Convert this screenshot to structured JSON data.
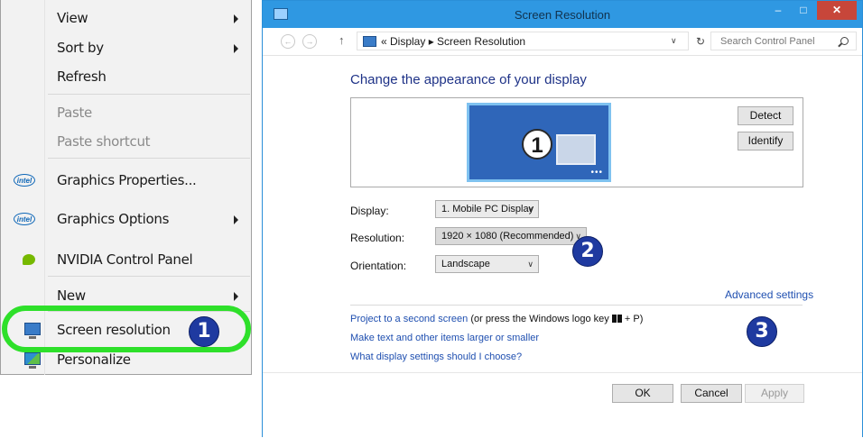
{
  "context_menu": {
    "items": [
      {
        "label": "View",
        "has_submenu": true,
        "disabled": false
      },
      {
        "label": "Sort by",
        "has_submenu": true,
        "disabled": false
      },
      {
        "label": "Refresh",
        "has_submenu": false,
        "disabled": false
      },
      {
        "label": "Paste",
        "has_submenu": false,
        "disabled": true
      },
      {
        "label": "Paste shortcut",
        "has_submenu": false,
        "disabled": true
      },
      {
        "label": "Graphics Properties...",
        "icon": "intel-icon",
        "has_submenu": false,
        "disabled": false
      },
      {
        "label": "Graphics Options",
        "icon": "intel-icon",
        "has_submenu": true,
        "disabled": false
      },
      {
        "label": "NVIDIA Control Panel",
        "icon": "nvidia-icon",
        "has_submenu": false,
        "disabled": false
      },
      {
        "label": "New",
        "has_submenu": true,
        "disabled": false
      },
      {
        "label": "Screen resolution",
        "icon": "monitor-icon",
        "has_submenu": false,
        "disabled": false
      },
      {
        "label": "Personalize",
        "icon": "personalize-icon",
        "has_submenu": false,
        "disabled": false
      }
    ],
    "intel_icon_text": "intel",
    "highlight_color": "#2ee02a"
  },
  "badges": {
    "one": "1",
    "two": "2",
    "three": "3",
    "color": "#1f3aa0"
  },
  "window": {
    "title": "Screen Resolution",
    "minimize": "–",
    "maximize": "□",
    "close": "✕",
    "nav_back": "←",
    "nav_forward": "→",
    "nav_up": "↑",
    "address": "« Display ▸ Screen Resolution",
    "address_dropdown": "∨",
    "refresh": "↻",
    "search_placeholder": "Search Control Panel",
    "heading": "Change the appearance of your display",
    "preview_number": "1",
    "preview_dots": "•••",
    "detect_label": "Detect",
    "identify_label": "Identify",
    "display_label": "Display:",
    "display_value": "1. Mobile PC Display",
    "resolution_label": "Resolution:",
    "resolution_value": "1920 × 1080 (Recommended)",
    "orientation_label": "Orientation:",
    "orientation_value": "Landscape",
    "select_chevron": "∨",
    "advanced_link": "Advanced settings",
    "link_project": "Project to a second screen",
    "link_project_suffix_a": "(or press the Windows logo key",
    "link_project_suffix_b": "+ P)",
    "link_text_size": "Make text and other items larger or smaller",
    "link_help": "What display settings should I choose?",
    "ok_label": "OK",
    "cancel_label": "Cancel",
    "apply_label": "Apply",
    "titlebar_color": "#2f98e2"
  }
}
